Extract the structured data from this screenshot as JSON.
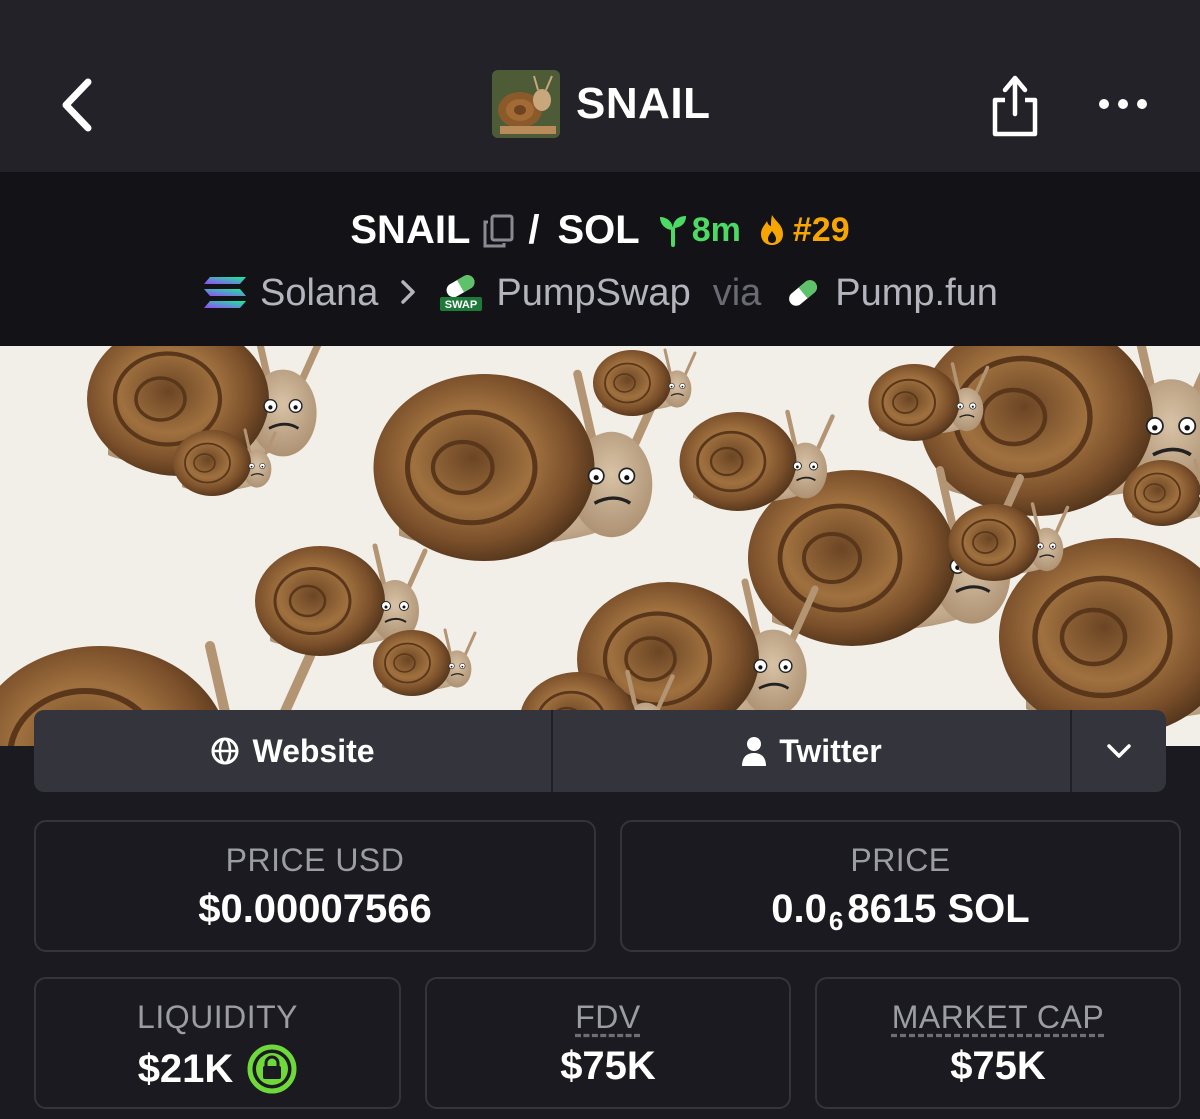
{
  "header": {
    "title": "SNAIL",
    "back_icon": "chevron-left-icon",
    "share_icon": "share-icon",
    "more_icon": "more-horizontal-icon"
  },
  "pair": {
    "base": "SNAIL",
    "separator": "/",
    "quote": "SOL",
    "age": "8m",
    "rank": "#29",
    "age_color": "#4cd964",
    "rank_color": "#f7a500"
  },
  "route": {
    "chain": "Solana",
    "dex": "PumpSwap",
    "via": "via",
    "launchpad": "Pump.fun",
    "dex_badge": "SWAP"
  },
  "links": {
    "website": "Website",
    "twitter": "Twitter"
  },
  "stats": {
    "price_usd_label": "PRICE USD",
    "price_usd_value": "$0.00007566",
    "price_label": "PRICE",
    "price_prefix": "0.0",
    "price_zeros": "6",
    "price_suffix": "8615 SOL",
    "liquidity_label": "LIQUIDITY",
    "liquidity_value": "$21K",
    "fdv_label": "FDV",
    "fdv_value": "$75K",
    "mcap_label": "MARKET CAP",
    "mcap_value": "$75K"
  },
  "colors": {
    "background": "#1a1a20",
    "topbar": "#222228",
    "pairbar": "#121217",
    "card_border": "#34343c",
    "lock_green": "#6fd83a"
  }
}
